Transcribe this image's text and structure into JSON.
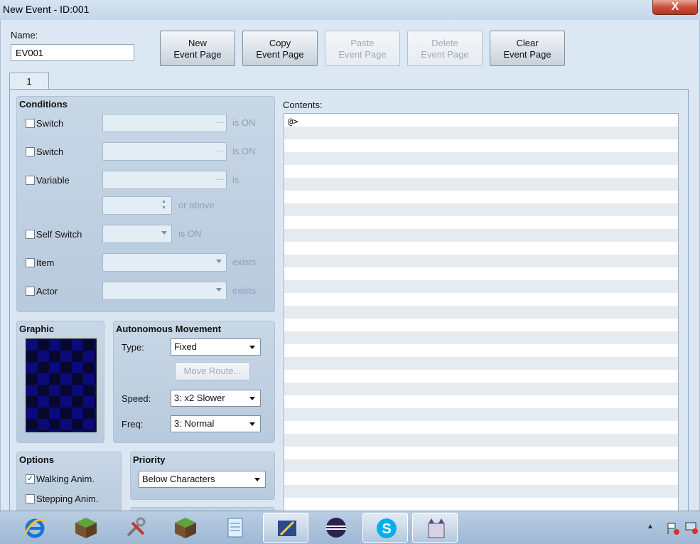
{
  "window": {
    "title": "New Event - ID:001",
    "close": "X"
  },
  "name": {
    "label": "Name:",
    "value": "EV001"
  },
  "page_buttons": [
    {
      "line1": "New",
      "line2": "Event Page",
      "enabled": true
    },
    {
      "line1": "Copy",
      "line2": "Event Page",
      "enabled": true
    },
    {
      "line1": "Paste",
      "line2": "Event Page",
      "enabled": false
    },
    {
      "line1": "Delete",
      "line2": "Event Page",
      "enabled": false
    },
    {
      "line1": "Clear",
      "line2": "Event Page",
      "enabled": true
    }
  ],
  "tab": {
    "label": "1"
  },
  "conditions": {
    "title": "Conditions",
    "switch1": {
      "label": "Switch",
      "suffix": "is ON",
      "checked": false,
      "ellipsis": "..."
    },
    "switch2": {
      "label": "Switch",
      "suffix": "is ON",
      "checked": false,
      "ellipsis": "..."
    },
    "variable": {
      "label": "Variable",
      "suffix": "is",
      "checked": false,
      "ellipsis": "...",
      "suffix2": "or above"
    },
    "self_switch": {
      "label": "Self Switch",
      "suffix": "is ON",
      "checked": false
    },
    "item": {
      "label": "Item",
      "suffix": "exists",
      "checked": false
    },
    "actor": {
      "label": "Actor",
      "suffix": "exists",
      "checked": false
    }
  },
  "graphic": {
    "title": "Graphic"
  },
  "autonomous": {
    "title": "Autonomous Movement",
    "type_label": "Type:",
    "type_value": "Fixed",
    "move_route": "Move Route...",
    "speed_label": "Speed:",
    "speed_value": "3: x2 Slower",
    "freq_label": "Freq:",
    "freq_value": "3: Normal"
  },
  "options": {
    "title": "Options",
    "walking": {
      "label": "Walking Anim.",
      "checked": true,
      "mark": "✓"
    },
    "stepping": {
      "label": "Stepping Anim.",
      "checked": false
    }
  },
  "priority": {
    "title": "Priority",
    "value": "Below Characters"
  },
  "contents": {
    "label": "Contents:",
    "first_line": "@>"
  },
  "taskbar": {
    "items": [
      "internet-explorer-icon",
      "minecraft-icon",
      "tools-icon",
      "minecraft-icon",
      "notepad-icon",
      "rpg-maker-icon",
      "eclipse-icon",
      "skype-icon",
      "game-icon"
    ]
  }
}
